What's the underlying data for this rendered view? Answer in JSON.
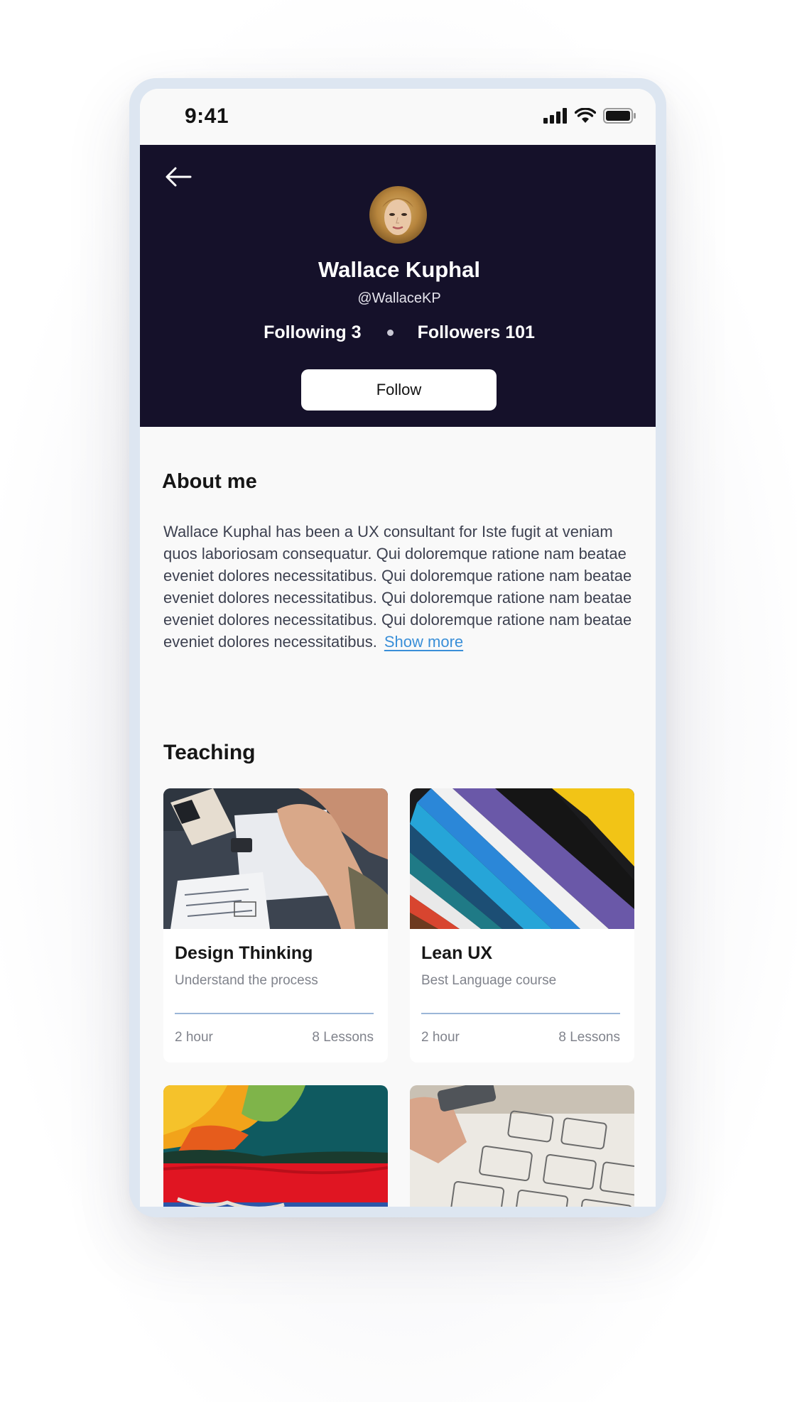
{
  "status_bar": {
    "time": "9:41"
  },
  "profile": {
    "name": "Wallace Kuphal",
    "handle": "@WallaceKP",
    "following_label": "Following 3",
    "followers_label": "Followers 101",
    "follow_button": "Follow"
  },
  "about": {
    "title": "About me",
    "body": "Wallace Kuphal has been a UX consultant for Iste fugit at veniam quos laboriosam consequatur. Qui doloremque ratione nam beatae eveniet dolores necessitatibus. Qui doloremque ratione nam beatae eveniet dolores necessitatibus. Qui doloremque ratione nam beatae eveniet dolores necessitatibus. Qui doloremque ratione nam beatae eveniet dolores necessitatibus.",
    "show_more": "Show more"
  },
  "teaching": {
    "title": "Teaching",
    "courses": [
      {
        "title": "Design Thinking",
        "subtitle": "Understand the process",
        "duration": "2 hour",
        "lessons": "8 Lessons"
      },
      {
        "title": "Lean UX",
        "subtitle": "Best Language course",
        "duration": "2 hour",
        "lessons": "8 Lessons"
      },
      {
        "title": "",
        "subtitle": "",
        "duration": "",
        "lessons": ""
      },
      {
        "title": "",
        "subtitle": "",
        "duration": "",
        "lessons": ""
      }
    ]
  },
  "colors": {
    "header_bg": "#15112a",
    "accent_link": "#3a8fd8",
    "frame": "#dde6f1"
  },
  "icons": [
    "back-arrow-icon",
    "signal-icon",
    "wifi-icon",
    "battery-icon"
  ]
}
